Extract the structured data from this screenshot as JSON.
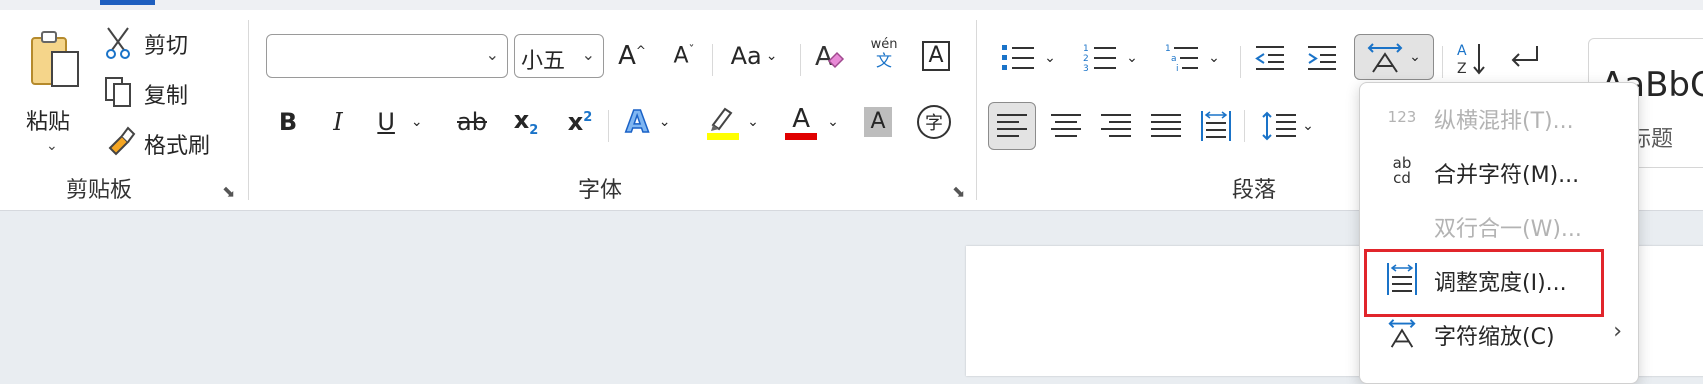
{
  "clipboard": {
    "paste_label": "粘贴",
    "cut_label": "剪切",
    "copy_label": "复制",
    "format_painter_label": "格式刷",
    "group_label": "剪贴板"
  },
  "font": {
    "font_name_value": "",
    "font_size_value": "小五",
    "grow_glyph": "A",
    "shrink_glyph": "A",
    "change_case_glyph": "Aa",
    "phonetic_top": "wén",
    "phonetic_char": "文",
    "border_char": "A",
    "bold": "B",
    "italic": "I",
    "underline": "U",
    "strike": "ab",
    "subscript_base": "x",
    "subscript_sub": "2",
    "superscript_base": "x",
    "superscript_sup": "2",
    "text_effect": "A",
    "font_color": "A",
    "shading": "A",
    "enclose_char": "字",
    "group_label": "字体",
    "highlight_color": "#ffff00",
    "font_color_bar": "#e00000"
  },
  "paragraph": {
    "group_label": "段落"
  },
  "styles": {
    "preview": "AaBbC",
    "label": "标题"
  },
  "menu": {
    "items": [
      {
        "icon": "123",
        "label": "纵横混排(T)...",
        "disabled": true
      },
      {
        "icon_top": "ab",
        "icon_bottom": "cd",
        "label": "合并字符(M)...",
        "disabled": false
      },
      {
        "label": "双行合一(W)...",
        "disabled": true
      },
      {
        "label": "调整宽度(I)...",
        "disabled": false
      },
      {
        "label": "字符缩放(C)",
        "disabled": false,
        "arrow": "›"
      }
    ]
  },
  "colors": {
    "accent": "#1f5fbf",
    "highlight_box": "#e1252b"
  }
}
